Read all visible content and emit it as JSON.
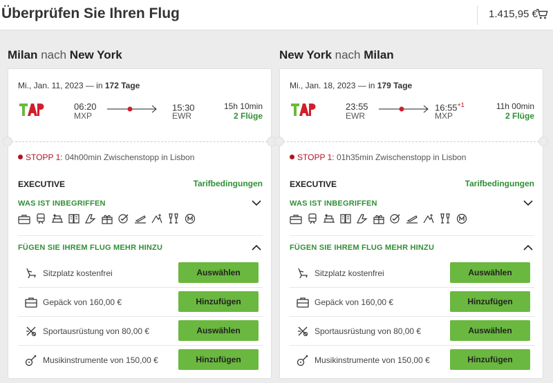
{
  "header": {
    "title": "Überprüfen Sie Ihren Flug",
    "price": "1.415,95 €"
  },
  "outbound": {
    "from": "Milan",
    "nach": "nach",
    "to": "New York",
    "date": "Mi., Jan. 11, 2023 — in",
    "days": "172 Tage",
    "dep_time": "06:20",
    "dep_code": "MXP",
    "arr_time": "15:30",
    "arr_plus": "",
    "arr_code": "EWR",
    "duration": "15h 10min",
    "flights": "2 Flüge",
    "stop_label": "STOPP 1:",
    "stop_text": "04h00min Zwischenstopp in Lisbon",
    "class": "EXECUTIVE",
    "tarif": "Tarifbedingungen",
    "included": "WAS IST INBEGRIFFEN",
    "add_more": "FÜGEN SIE IHREM FLUG MEHR HINZU",
    "addons": [
      {
        "icon": "seat-icon",
        "label": "Sitzplatz kostenfrei",
        "button": "Auswählen"
      },
      {
        "icon": "luggage-icon",
        "label": "Gepäck von 160,00 €",
        "button": "Hinzufügen"
      },
      {
        "icon": "sport-equipment-icon",
        "label": "Sportausrüstung von 80,00 €",
        "button": "Auswählen"
      },
      {
        "icon": "guitar-icon",
        "label": "Musikinstrumente von 150,00 €",
        "button": "Hinzufügen"
      }
    ]
  },
  "inbound": {
    "from": "New York",
    "nach": "nach",
    "to": "Milan",
    "date": "Mi., Jan. 18, 2023 — in",
    "days": "179 Tage",
    "dep_time": "23:55",
    "dep_code": "EWR",
    "arr_time": "16:55",
    "arr_plus": "+1",
    "arr_code": "MXP",
    "duration": "11h 00min",
    "flights": "2 Flüge",
    "stop_label": "STOPP 1:",
    "stop_text": "01h35min Zwischenstopp in Lisbon",
    "class": "EXECUTIVE",
    "tarif": "Tarifbedingungen",
    "included": "WAS IST INBEGRIFFEN",
    "add_more": "FÜGEN SIE IHREM FLUG MEHR HINZU",
    "addons": [
      {
        "icon": "seat-icon",
        "label": "Sitzplatz kostenfrei",
        "button": "Auswählen"
      },
      {
        "icon": "luggage-icon",
        "label": "Gepäck von 160,00 €",
        "button": "Hinzufügen"
      },
      {
        "icon": "sport-equipment-icon",
        "label": "Sportausrüstung von 80,00 €",
        "button": "Auswählen"
      },
      {
        "icon": "guitar-icon",
        "label": "Musikinstrumente von 150,00 €",
        "button": "Hinzufügen"
      }
    ]
  },
  "included_icons": [
    "briefcase-icon",
    "train-icon",
    "lounge-icon",
    "menu-icon",
    "fast-track-icon",
    "gift-icon",
    "check-icon",
    "flight-icon",
    "upgrade-icon",
    "drinks-icon",
    "miles-icon"
  ],
  "colors": {
    "accent_green": "#2f8f35",
    "button_green": "#6ab83f",
    "stop_red": "#b3121f"
  }
}
